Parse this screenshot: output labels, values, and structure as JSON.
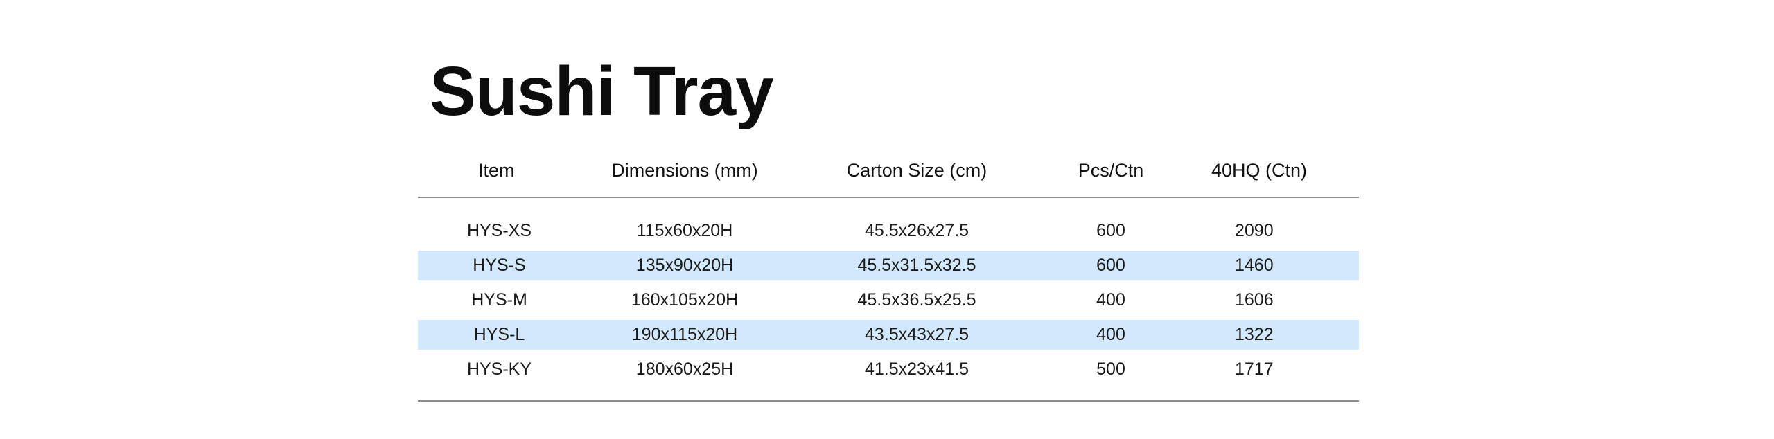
{
  "title": "Sushi Tray",
  "columns": [
    "Item",
    "Dimensions (mm)",
    "Carton Size (cm)",
    "Pcs/Ctn",
    "40HQ (Ctn)"
  ],
  "rows": [
    {
      "item": "HYS-XS",
      "dimensions": "115x60x20H",
      "carton": "45.5x26x27.5",
      "pcs": "600",
      "hq": "2090"
    },
    {
      "item": "HYS-S",
      "dimensions": "135x90x20H",
      "carton": "45.5x31.5x32.5",
      "pcs": "600",
      "hq": "1460"
    },
    {
      "item": "HYS-M",
      "dimensions": "160x105x20H",
      "carton": "45.5x36.5x25.5",
      "pcs": "400",
      "hq": "1606"
    },
    {
      "item": "HYS-L",
      "dimensions": "190x115x20H",
      "carton": "43.5x43x27.5",
      "pcs": "400",
      "hq": "1322"
    },
    {
      "item": "HYS-KY",
      "dimensions": "180x60x25H",
      "carton": "41.5x23x41.5",
      "pcs": "500",
      "hq": "1717"
    }
  ],
  "colors": {
    "stripe": "#d2e8fc",
    "rule": "#8a8a8a",
    "text": "#1a1a1a"
  }
}
